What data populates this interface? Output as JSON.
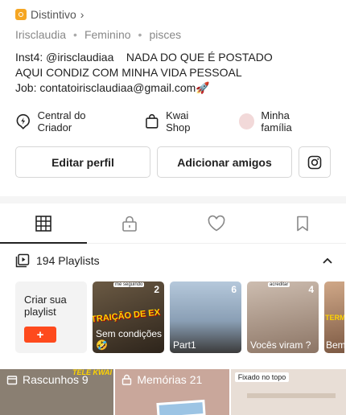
{
  "profile": {
    "badge": "Distintivo",
    "username": "Irisclaudia",
    "gender": "Feminino",
    "sign": "pisces",
    "bio_line1": "Inst4: @irisclaudiaa    NADA DO QUE É POSTADO",
    "bio_line2": "AQUI CONDIZ COM MINHA VIDA PESSOAL",
    "bio_line3": "Job: contatoirisclaudiaa@gmail.com🚀"
  },
  "links": {
    "creator": "Central do Criador",
    "shop": "Kwai Shop",
    "family": "Minha família"
  },
  "buttons": {
    "edit": "Editar perfil",
    "add_friends": "Adicionar amigos"
  },
  "playlists": {
    "count_label": "194 Playlists",
    "create_label": "Criar sua playlist",
    "create_plus": "+",
    "items": [
      {
        "count": "2",
        "tag": "me seguindo",
        "caption": "Sem condições 🤣",
        "overlay": "TRAIÇÃO DE EX",
        "color": "#4a3a2a"
      },
      {
        "count": "6",
        "tag": "",
        "caption": "Part1",
        "overlay": "",
        "color": "#8fa9c4"
      },
      {
        "count": "4",
        "tag": "acreditar",
        "caption": "Vocês viram ?",
        "overlay": "",
        "color": "#a9998c"
      },
      {
        "count": "",
        "tag": "",
        "caption": "Bem vi",
        "overlay": "TERM",
        "color": "#b08a70"
      }
    ]
  },
  "grid": {
    "drafts": "Rascunhos 9",
    "memories": "Memórias 21",
    "pinned": "Fixado no topo",
    "kwai_text": "TELE KWAI"
  },
  "colors": {
    "accent": "#fe4a1d",
    "badge": "#f5a623"
  }
}
